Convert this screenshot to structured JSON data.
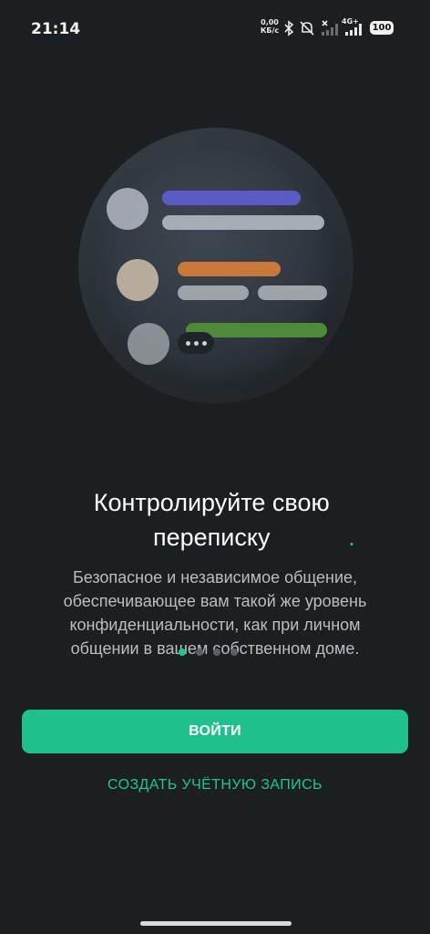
{
  "status_bar": {
    "time": "21:14",
    "net_speed_value": "0,00",
    "net_speed_unit": "КБ/с",
    "network_type": "4G+",
    "battery": "100",
    "icons": [
      "bluetooth-icon",
      "mute-icon",
      "signal-x-icon",
      "signal-4g-icon"
    ]
  },
  "onboarding": {
    "title_text": "Контролируйте свою переписку",
    "title_accent": ".",
    "description": "Безопасное и независимое общение, обеспечивающее вам такой же уровень конфиденциальности, как при личном общении в вашем собственном доме.",
    "pager": {
      "total": 4,
      "active_index": 0
    }
  },
  "actions": {
    "login_label": "ВОЙТИ",
    "create_account_label": "СОЗДАТЬ УЧЁТНУЮ ЗАПИСЬ"
  },
  "colors": {
    "accent": "#1fc08c",
    "background": "#1b1f22",
    "bar_purple": "#5b5bc8",
    "bar_orange": "#c9783a",
    "bar_green": "#4e8a3a"
  }
}
